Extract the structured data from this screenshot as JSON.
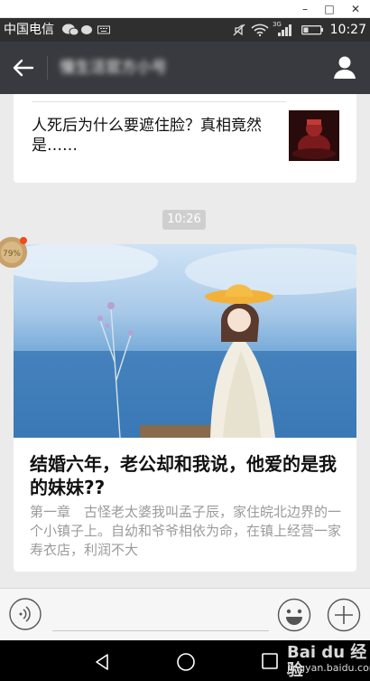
{
  "window": {
    "minimize_glyph": "–",
    "maximize_glyph": "□",
    "close_glyph": "✕"
  },
  "status_bar": {
    "carrier": "中国电信",
    "network": "3G",
    "time": "10:27"
  },
  "nav": {
    "title": "慢生活官方小号"
  },
  "chat": {
    "prev_card": {
      "title": "人死后为什么要遮住脸？真相竟然是……"
    },
    "timestamp": "10:26",
    "article_card": {
      "title": "结婚六年，老公却和我说，他爱的是我的妹妹??",
      "summary": "第一章　古怪老太婆我叫孟子辰，家住皖北边界的一个小镇子上。自幼和爷爷相依为命，在镇上经营一家寿衣店，利润不大"
    },
    "avatar_label": "79%"
  },
  "watermark": {
    "brand": "Bai du 经验",
    "url": "jingyan.baidu.com"
  },
  "colors": {
    "nav_background": "#393a3f",
    "chat_background": "#ebebeb",
    "status_background": "#2f2f2f"
  }
}
